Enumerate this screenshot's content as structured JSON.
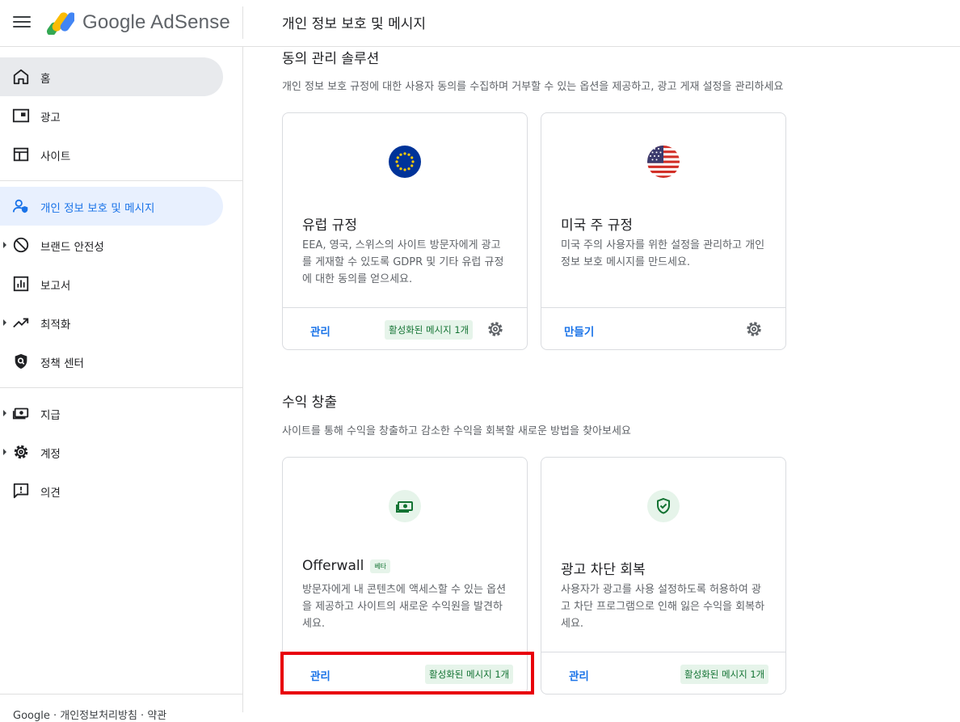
{
  "header": {
    "app_name": "Google AdSense",
    "page_title": "개인 정보 보호 및 메시지"
  },
  "sidebar": {
    "items": [
      {
        "label": "홈",
        "icon": "home-icon"
      },
      {
        "label": "광고",
        "icon": "ads-icon"
      },
      {
        "label": "사이트",
        "icon": "sites-icon"
      },
      {
        "label": "개인 정보 보호 및 메시지",
        "icon": "privacy-icon"
      },
      {
        "label": "브랜드 안전성",
        "icon": "block-icon"
      },
      {
        "label": "보고서",
        "icon": "reports-icon"
      },
      {
        "label": "최적화",
        "icon": "trending-icon"
      },
      {
        "label": "정책 센터",
        "icon": "policy-icon"
      },
      {
        "label": "지급",
        "icon": "payments-icon"
      },
      {
        "label": "계정",
        "icon": "gear-icon"
      },
      {
        "label": "의견",
        "icon": "feedback-icon"
      }
    ],
    "footer": "Google · 개인정보처리방침 · 약관"
  },
  "consent": {
    "title": "동의 관리 솔루션",
    "description": "개인 정보 보호 규정에 대한 사용자 동의를 수집하며 거부할 수 있는 옵션을 제공하고, 광고 게재 설정을 관리하세요",
    "cards": [
      {
        "title": "유럽 규정",
        "description": "EEA, 영국, 스위스의 사이트 방문자에게 광고를 게재할 수 있도록 GDPR 및 기타 유럽 규정에 대한 동의를 얻으세요.",
        "action": "관리",
        "badge": "활성화된 메시지 1개"
      },
      {
        "title": "미국 주 규정",
        "description": "미국 주의 사용자를 위한 설정을 관리하고 개인 정보 보호 메시지를 만드세요.",
        "action": "만들기"
      }
    ]
  },
  "monetization": {
    "title": "수익 창출",
    "description": "사이트를 통해 수익을 창출하고 감소한 수익을 회복할 새로운 방법을 찾아보세요",
    "cards": [
      {
        "title": "Offerwall",
        "tag": "베타",
        "description": "방문자에게 내 콘텐츠에 액세스할 수 있는 옵션을 제공하고 사이트의 새로운 수익원을 발견하세요.",
        "action": "관리",
        "badge": "활성화된 메시지 1개"
      },
      {
        "title": "광고 차단 회복",
        "description": "사용자가 광고를 사용 설정하도록 허용하여 광고 차단 프로그램으로 인해 잃은 수익을 회복하세요.",
        "action": "관리",
        "badge": "활성화된 메시지 1개"
      }
    ]
  },
  "colors": {
    "accent": "#1a73e8",
    "badge_green": "#137333",
    "highlight": "#e8000b"
  }
}
